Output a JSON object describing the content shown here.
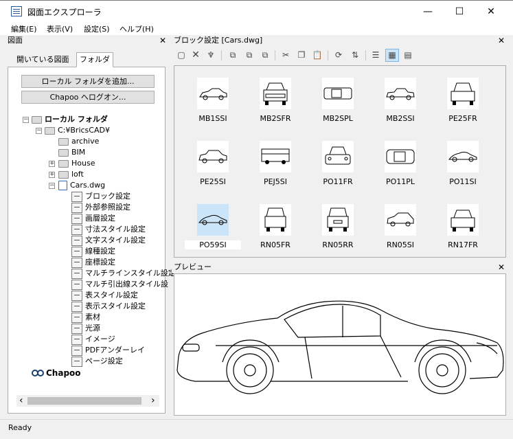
{
  "window": {
    "title": "図面エクスプローラ",
    "minimize": "—",
    "maximize": "☐",
    "close": "✕"
  },
  "menu": [
    "編集(E)",
    "表示(V)",
    "設定(S)",
    "ヘルプ(H)"
  ],
  "left_panel": {
    "title": "図面",
    "close": "✕",
    "tabs": [
      "開いている図面",
      "フォルダ"
    ],
    "buttons": [
      "ローカル フォルダを追加...",
      "Chapoo へログオン..."
    ],
    "tree": {
      "local_folder": "ローカル フォルダ",
      "bricscad": "C:¥BricsCAD¥",
      "folders": [
        "archive",
        "BIM",
        "House",
        "loft"
      ],
      "file": "Cars.dwg",
      "settings": [
        "ブロック設定",
        "外部参照設定",
        "画層設定",
        "寸法スタイル設定",
        "文字スタイル設定",
        "線種設定",
        "座標設定",
        "マルチラインスタイル設定",
        "マルチ引出線スタイル設",
        "表スタイル設定",
        "表示スタイル設定",
        "素材",
        "光源",
        "イメージ",
        "PDFアンダーレイ",
        "ページ設定"
      ],
      "chapoo": "Chapoo"
    },
    "scroll_left": "‹",
    "scroll_right": "›"
  },
  "block_panel": {
    "title": "ブロック設定 [Cars.dwg]",
    "close": "✕",
    "toolbar_icons": [
      "new-block-icon",
      "delete-icon",
      "purge-brush-icon",
      "insert-icon",
      "insert-copy-icon",
      "redefine-icon",
      "cut-icon",
      "copy-icon",
      "paste-icon",
      "refresh-icon",
      "sync-icon",
      "list-view-icon",
      "thumbnail-view-icon",
      "detail-view-icon"
    ],
    "blocks": [
      "MB1SSI",
      "MB2SFR",
      "MB2SPL",
      "MB2SSI",
      "PE25FR",
      "PE25SI",
      "PEJ5SI",
      "PO11FR",
      "PO11PL",
      "PO11SI",
      "PO59SI",
      "RN05FR",
      "RN05RR",
      "RN05SI",
      "RN17FR"
    ],
    "selected_block": "PO59SI"
  },
  "preview_panel": {
    "title": "プレビュー",
    "close": "✕"
  },
  "status": {
    "text": "Ready"
  }
}
